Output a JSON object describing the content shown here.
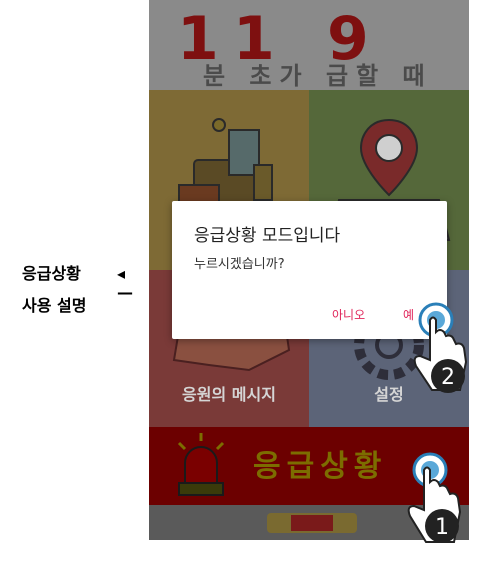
{
  "caption": {
    "line1": "응급상황",
    "line2": "사용 설명"
  },
  "header": {
    "digits": [
      "1",
      "1",
      "9"
    ],
    "subtitle": "분 초가 급할 때"
  },
  "tiles": [
    {
      "label": ""
    },
    {
      "label": ""
    },
    {
      "label": "응원의 메시지"
    },
    {
      "label": "설정"
    }
  ],
  "emergency": {
    "label": "응급상황"
  },
  "dialog": {
    "title": "응급상황 모드입니다",
    "message": "누르시겠습니까?",
    "no_label": "아니오",
    "yes_label": "예"
  },
  "steps": [
    "1",
    "2"
  ],
  "colors": {
    "accent": "#e0255a",
    "emergency_red": "#cc0000"
  }
}
